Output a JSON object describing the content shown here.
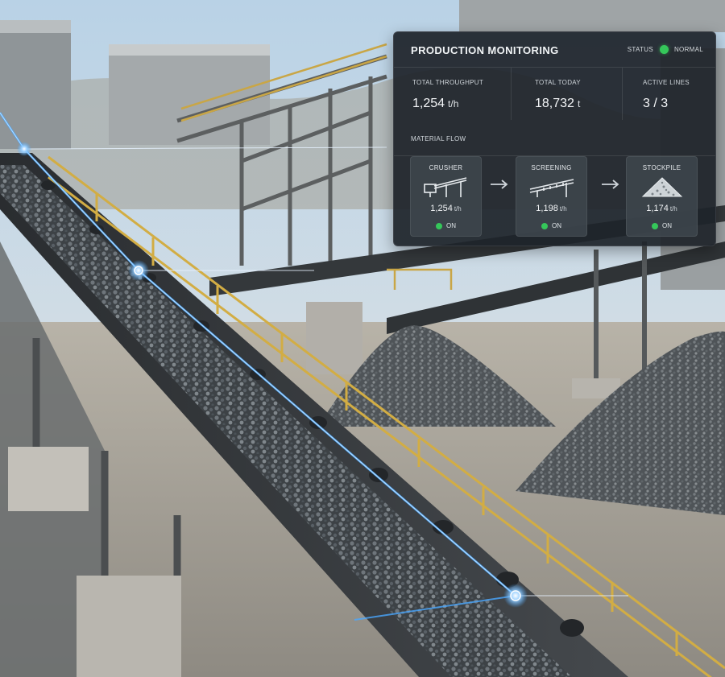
{
  "panel": {
    "title": "PRODUCTION MONITORING",
    "status_label": "STATUS",
    "status_value": "NORMAL",
    "status_color": "#35c75a"
  },
  "kpis": [
    {
      "label": "TOTAL THROUGHPUT",
      "value": "1,254",
      "unit": "t/h"
    },
    {
      "label": "TOTAL TODAY",
      "value": "18,732",
      "unit": "t"
    },
    {
      "label": "ACTIVE LINES",
      "value": "3 / 3",
      "unit": ""
    }
  ],
  "flow": {
    "title": "MATERIAL FLOW",
    "stages": [
      {
        "name": "CRUSHER",
        "icon": "crusher-conveyor-icon",
        "value": "1,254",
        "unit": "t/h",
        "state": "ON"
      },
      {
        "name": "SCREENING",
        "icon": "screening-conveyor-icon",
        "value": "1,198",
        "unit": "t/h",
        "state": "ON"
      },
      {
        "name": "STOCKPILE",
        "icon": "stockpile-icon",
        "value": "1,174",
        "unit": "t/h",
        "state": "ON"
      }
    ],
    "arrow_icon": "arrow-right-icon"
  },
  "colors": {
    "panel_bg": "#1e242a",
    "status_ok": "#35c75a",
    "belt_glow": "#4aa8ff"
  }
}
